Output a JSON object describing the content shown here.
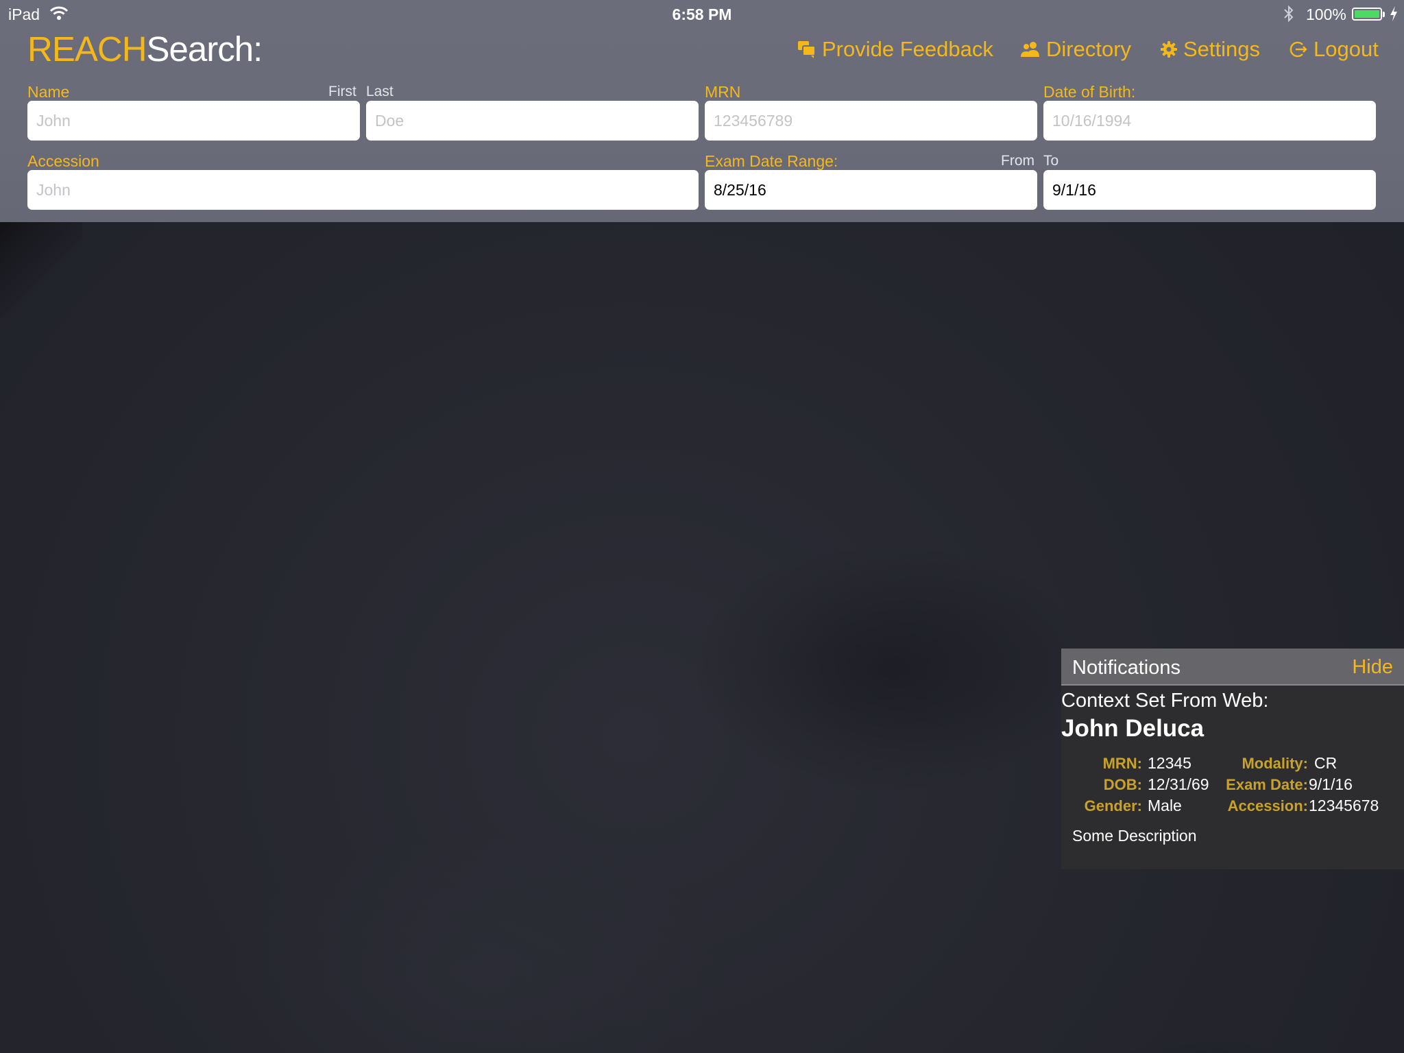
{
  "status_bar": {
    "device": "iPad",
    "time": "6:58 PM",
    "battery": "100%",
    "battery_color": "#4cd964"
  },
  "app": {
    "logo_primary": "REACH",
    "logo_secondary": "Search:",
    "accent_color": "#f5b81a"
  },
  "nav": {
    "feedback": "Provide Feedback",
    "directory": "Directory",
    "settings": "Settings",
    "logout": "Logout"
  },
  "form": {
    "name_label": "Name",
    "first_label": "First",
    "last_label": "Last",
    "first_placeholder": "John",
    "last_placeholder": "Doe",
    "mrn_label": "MRN",
    "mrn_placeholder": "123456789",
    "dob_label": "Date of Birth:",
    "dob_placeholder": "10/16/1994",
    "accession_label": "Accession",
    "accession_placeholder": "John",
    "exam_range_label": "Exam Date Range:",
    "from_label": "From",
    "to_label": "To",
    "from_value": "8/25/16",
    "to_value": "9/1/16"
  },
  "notifications": {
    "title": "Notifications",
    "hide": "Hide",
    "context": "Context Set From Web:",
    "patient_name": "John Deluca",
    "mrn_key": "MRN:",
    "mrn_val": "12345",
    "dob_key": "DOB:",
    "dob_val": "12/31/69",
    "gender_key": "Gender:",
    "gender_val": "Male",
    "modality_key": "Modality:",
    "modality_val": "CR",
    "exam_date_key": "Exam Date:",
    "exam_date_val": "9/1/16",
    "accession_key": "Accession:",
    "accession_val": "12345678",
    "description": "Some Description"
  }
}
